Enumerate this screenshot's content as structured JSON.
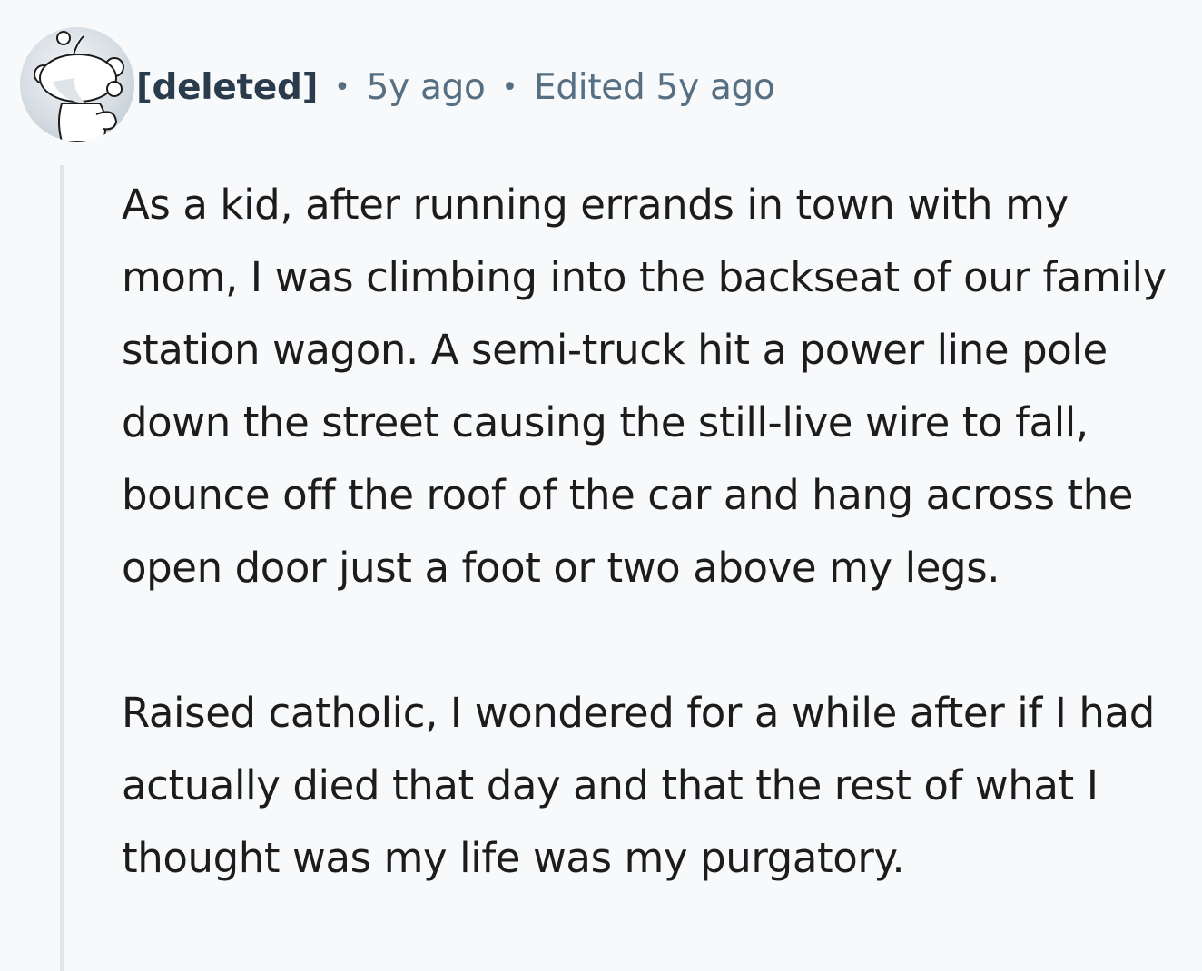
{
  "comment": {
    "author": "[deleted]",
    "separator": "•",
    "posted_time": "5y ago",
    "edited_label": "Edited 5y ago",
    "paragraphs": [
      "As a kid, after running errands in town with my mom, I was climbing into the backseat of our family station wagon. A semi-truck hit a power line pole down the street causing the still-live wire to fall, bounce off the roof of the car and hang across the open door just a foot or two above my legs.",
      "Raised catholic, I wondered for a while after if I had actually died that day and that the rest of what I thought was my life was my purgatory."
    ]
  },
  "avatar": {
    "icon": "snoo-avatar-icon"
  },
  "colors": {
    "background": "#f7f9fa",
    "author": "#2a3c4b",
    "meta": "#576f82",
    "body_text": "#1c1c1c",
    "thread_line": "#e0e5ea"
  }
}
